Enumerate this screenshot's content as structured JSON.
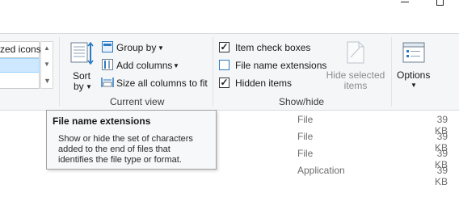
{
  "ribbon": {
    "layout": {
      "visible_option": "zed icons"
    },
    "current_view": {
      "sort_label_1": "Sort",
      "sort_label_2": "by",
      "group_by": "Group by",
      "add_columns": "Add columns",
      "size_all_columns": "Size all columns to fit",
      "group_label": "Current view"
    },
    "show_hide": {
      "item_check_boxes": {
        "label": "Item check boxes",
        "checked": true
      },
      "file_name_extensions": {
        "label": "File name extensions",
        "checked": false
      },
      "hidden_items": {
        "label": "Hidden items",
        "checked": true
      },
      "hide_selected_1": "Hide selected",
      "hide_selected_2": "items",
      "group_label": "Show/hide"
    },
    "options": {
      "label": "Options"
    }
  },
  "tooltip": {
    "title": "File name extensions",
    "line1": "Show or hide the set of characters",
    "line2": "added to the end of files that",
    "line3": "identifies the file type or format."
  },
  "files": [
    {
      "type": "File",
      "size": "39 KB"
    },
    {
      "type": "File",
      "size": "39 KB"
    },
    {
      "type": "File",
      "size": "39 KB"
    },
    {
      "type": "Application",
      "size": "39 KB"
    }
  ],
  "colors": {
    "selection": "#cde8ff",
    "ribbon_bg": "#f5f6f7",
    "icon_blue": "#2b79c4"
  }
}
